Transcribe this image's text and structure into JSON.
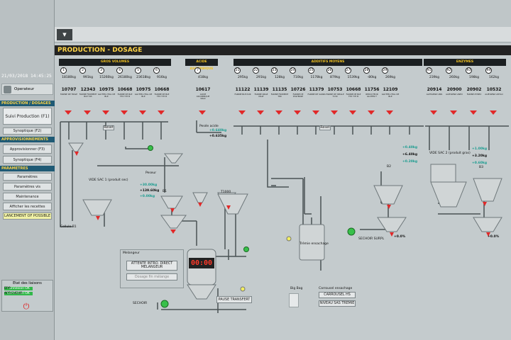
{
  "sidebar": {
    "clock": "21/03/2018 14:45:25",
    "operator": "Operateur",
    "sections": {
      "production": "PRODUCTION / DOSAGES",
      "appro": "APPROVISIONNEMENTS",
      "params": "PARAMETRES"
    },
    "buttons": {
      "suivi": "Suivi Production (F1)",
      "synoptique_f2": "Synoptique (F2)",
      "approvisionner": "Approvisionner (F3)",
      "synoptique_f4": "Synoptique (F4)",
      "parametres": "Paramètres",
      "parametres_vis": "Paramètres vis",
      "maintenance": "Maintenance",
      "afficher": "Afficher les recettes",
      "lancement": "LANCEMENT OF POSSIBLE"
    },
    "status": {
      "title": "Etat des liaisons",
      "rows": [
        {
          "label": "ERP",
          "value": "Connexion OK"
        },
        {
          "label": "AFFICHEUR",
          "value": "Connexion OK"
        }
      ]
    }
  },
  "main": {
    "title": "PRODUCTION - DOSAGE",
    "groups": {
      "gros": "GROS VOLUMES",
      "acide": "ACIDE ASCORBIQUE",
      "additifs": "ADDITIFS MOYENS",
      "enzymes": "ENZYMES"
    },
    "hoppers": [
      {
        "n": "1",
        "w": "18180kg",
        "t": "10707",
        "name": "FARINE DE TRIGE"
      },
      {
        "n": "2",
        "w": "991kg",
        "t": "12343",
        "name": "FARINE FROMENT BLE T45"
      },
      {
        "n": "3",
        "w": "15260kg",
        "t": "10975",
        "name": "GLUTEN VITAL DE BLE"
      },
      {
        "n": "4",
        "w": "26180kg",
        "t": "10668",
        "name": "FARINE DE BLE T55 TYP B"
      },
      {
        "n": "5",
        "w": "23618kg",
        "t": "10975",
        "name": "GLUTEN VITAL DE BLE"
      },
      {
        "n": "6",
        "w": "916kg",
        "t": "10668",
        "name": "FARINE DE BLE T55 TYP B"
      },
      {
        "n": "7",
        "w": "418kg",
        "t": "10617",
        "name": "ACIDE ASCORBIQUE VRAC"
      },
      {
        "n": "21",
        "w": "295kg",
        "t": "11122",
        "name": "FARINE BLE DUR"
      },
      {
        "n": "22",
        "w": "291kg",
        "t": "11139",
        "name": "FARINE ORGE MALT"
      },
      {
        "n": "23",
        "w": "128kg",
        "t": "11135",
        "name": "FARINE FROMENT T80"
      },
      {
        "n": "24",
        "w": "710kg",
        "t": "10726",
        "name": "FARINE DE POLYBASE"
      },
      {
        "n": "25",
        "w": "1178kg",
        "t": "11379",
        "name": "FARINE DE SARRA"
      },
      {
        "n": "26",
        "w": "879kg",
        "t": "10753",
        "name": "FARINE DE SEIGLE T130"
      },
      {
        "n": "27",
        "w": "1539kg",
        "t": "10668",
        "name": "FARINE DE BLE T55 TYP B"
      },
      {
        "n": "28",
        "w": "-80kg",
        "t": "11756",
        "name": "REDUCTEUR GLUTEN T"
      },
      {
        "n": "29",
        "w": "269kg",
        "t": "12109",
        "name": "GLUTEN VITAL DE BLE"
      },
      {
        "n": "91",
        "w": "239kg",
        "t": "20914",
        "name": "ALPHAENZ UNIS"
      },
      {
        "n": "92",
        "w": "260kg",
        "t": "20900",
        "name": "ALPHAENZ ANEU"
      },
      {
        "n": "93",
        "w": "198kg",
        "t": "20902",
        "name": "FARINE ZYMEX"
      },
      {
        "n": "94",
        "w": "162kg",
        "t": "10532",
        "name": "ALPHAENZ AMYLO"
      }
    ],
    "labels": {
      "vide_sac1": "VIDE SAC 1 (produit sec)",
      "vide_sac2": "VIDE SAC 2 (produit gras)",
      "t1000": "T1000",
      "b1": "B1",
      "b2": "B2",
      "b3": "B3",
      "tremie": "Trémie ensachage",
      "big_bag": "Big Bag",
      "carrousel": "Carrousel ensachage",
      "sechoir": "SECHOIR",
      "surpl": "SECHOIR SURPL",
      "peseur": "Peseur",
      "melangeur": "Melangeur",
      "cellule": "Cellule B1",
      "pesee_acide": "Pesée acide"
    },
    "weights": {
      "w_acide1": "+0.640kg",
      "w_acide2": "+0.635kg",
      "w_b1a": "+30.00kg",
      "w_b1b": "+139.60kg",
      "w_b1c": "+0.00kg",
      "w_b2a": "+0.40kg",
      "w_b2b": "+6.40kg",
      "w_b2c": "+0.20kg",
      "w_b3a": "+1.00kg",
      "w_b3b": "+3.20kg",
      "w_b3c": "+0.60kg",
      "pct1": "+0.0%",
      "pct2": "+0.0%"
    },
    "timer": "00:00",
    "buttons": {
      "attente": "ATTENTE INTRO. DIRECT MELANGEUR",
      "dosage": "Dosage fin mélange",
      "pause": "PAUSE TRANSFERT",
      "carrousel_hs": "CARROUSEL HS",
      "niveau": "NIVEAU SAS TREMIE",
      "reset": "Reset",
      "reset2": "Reset"
    }
  }
}
